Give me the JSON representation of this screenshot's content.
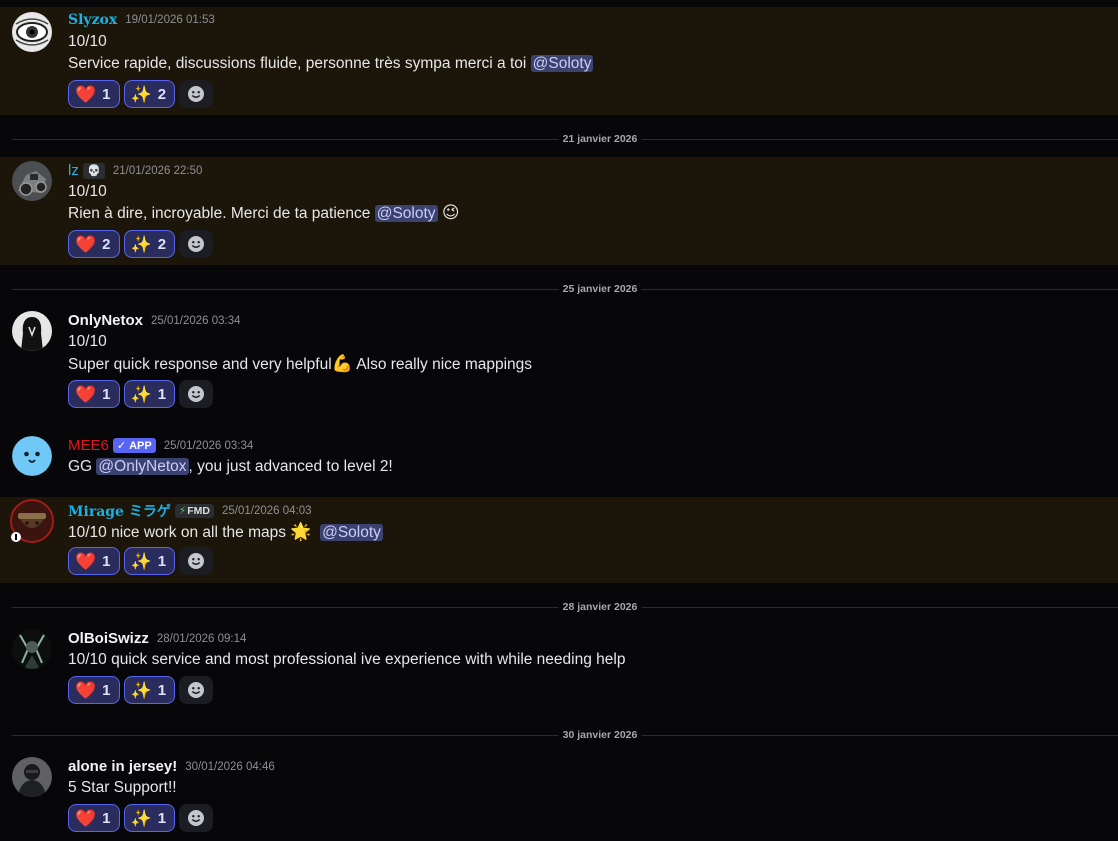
{
  "messages": [
    {
      "username": "Slyzox",
      "timestamp": "19/01/2026 01:53",
      "line1": "10/10",
      "line2_text": "Service rapide, discussions fluide, personne très sympa merci a toi ",
      "line2_mention": "@Soloty",
      "reactions": [
        {
          "emoji": "❤️",
          "count": "1"
        },
        {
          "emoji": "✨",
          "count": "2"
        }
      ]
    },
    {
      "username": "lz",
      "timestamp": "21/01/2026 22:50",
      "line1": "10/10",
      "line2_text": "Rien à dire, incroyable. Merci de ta patience ",
      "line2_mention": "@Soloty",
      "line2_emoji": "😉",
      "reactions": [
        {
          "emoji": "❤️",
          "count": "2"
        },
        {
          "emoji": "✨",
          "count": "2"
        }
      ]
    },
    {
      "username": "OnlyNetox",
      "timestamp": "25/01/2026 03:34",
      "line1": "10/10",
      "line2_text": "Super quick response and very helpful",
      "line2_emoji": "💪",
      "line2_after": " Also really nice mappings",
      "reactions": [
        {
          "emoji": "❤️",
          "count": "1"
        },
        {
          "emoji": "✨",
          "count": "1"
        }
      ]
    },
    {
      "username": "MEE6",
      "badge": "APP",
      "timestamp": "25/01/2026 03:34",
      "line_before": "GG ",
      "line_mention": "@OnlyNetox",
      "line_after": ", you just advanced to level 2!"
    },
    {
      "username": "Mirage ミラゲ",
      "tag": "FMD",
      "timestamp": "25/01/2026 04:03",
      "line_text": "10/10 nice work on all the maps ",
      "line_emoji": "🌟",
      "line_mention": "@Soloty",
      "reactions": [
        {
          "emoji": "❤️",
          "count": "1"
        },
        {
          "emoji": "✨",
          "count": "1"
        }
      ]
    },
    {
      "username": "OlBoiSwizz",
      "timestamp": "28/01/2026 09:14",
      "line1": "10/10 quick service and most professional ive experience with while needing help",
      "reactions": [
        {
          "emoji": "❤️",
          "count": "1"
        },
        {
          "emoji": "✨",
          "count": "1"
        }
      ]
    },
    {
      "username": "alone in jersey!",
      "timestamp": "30/01/2026 04:46",
      "line1": "5 Star Support!!",
      "reactions": [
        {
          "emoji": "❤️",
          "count": "1"
        },
        {
          "emoji": "✨",
          "count": "1"
        }
      ]
    }
  ],
  "dividers": [
    "21 janvier 2026",
    "25 janvier 2026",
    "28 janvier 2026",
    "30 janvier 2026"
  ],
  "icons": {
    "add_reaction": "smiley-add-icon",
    "heart": "❤️",
    "sparkles": "✨",
    "checkmark": "✓",
    "bolt": "⚡",
    "skull": "💀"
  },
  "colors": {
    "username_cyan": "#1ab1e6",
    "mee6_red": "#e0161f",
    "mention_bg": "#3c4270",
    "reaction_border": "#5865f2",
    "highlight_bg": "#1b1609"
  }
}
